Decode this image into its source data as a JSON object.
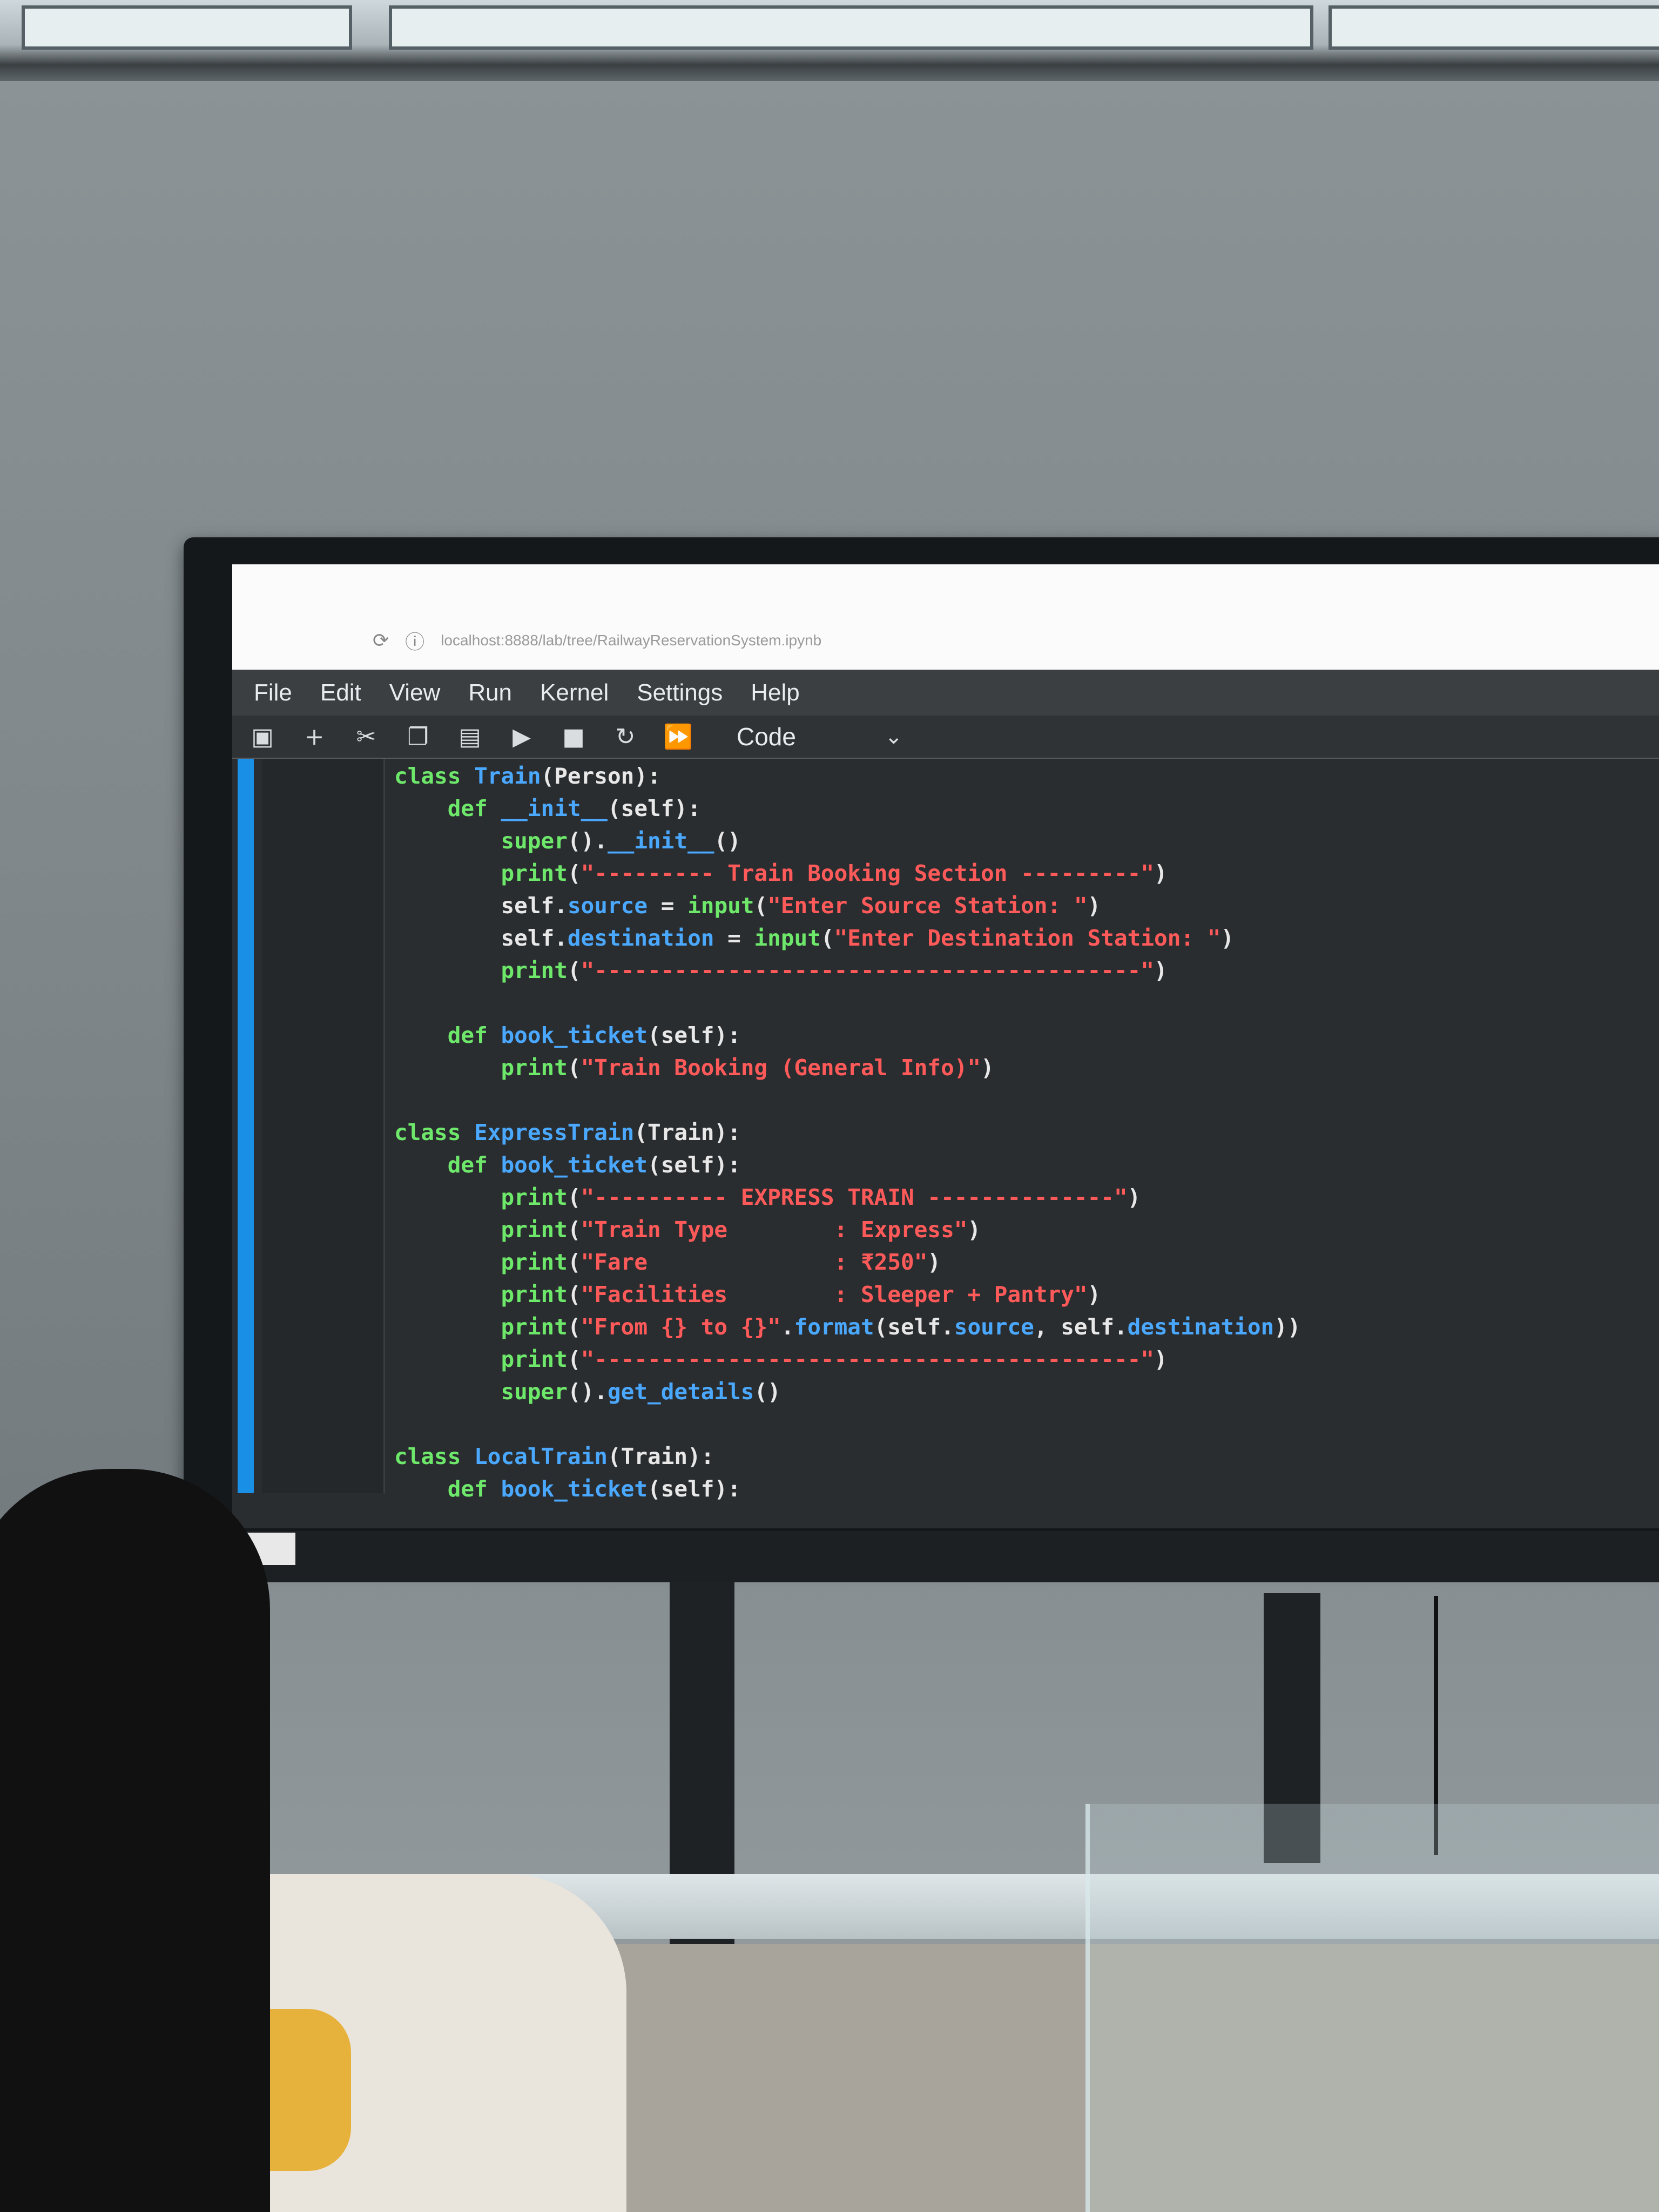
{
  "browser": {
    "url": "localhost:8888/lab/tree/RailwayReservationSystem.ipynb"
  },
  "menubar": {
    "items": [
      "File",
      "Edit",
      "View",
      "Run",
      "Kernel",
      "Settings",
      "Help"
    ]
  },
  "toolbar": {
    "icons": [
      "save-icon",
      "add-cell-icon",
      "cut-icon",
      "copy-icon",
      "paste-icon",
      "run-icon",
      "stop-icon",
      "restart-icon",
      "fast-forward-icon"
    ],
    "cell_type": "Code"
  },
  "code_lines": [
    "class Train(Person):",
    "    def __init__(self):",
    "        super().__init__()",
    "        print(\"--------- Train Booking Section ---------\")",
    "        self.source = input(\"Enter Source Station: \")",
    "        self.destination = input(\"Enter Destination Station: \")",
    "        print(\"-----------------------------------------\")",
    "",
    "    def book_ticket(self):",
    "        print(\"Train Booking (General Info)\")",
    "",
    "class ExpressTrain(Train):",
    "    def book_ticket(self):",
    "        print(\"---------- EXPRESS TRAIN --------------\")",
    "        print(\"Train Type        : Express\")",
    "        print(\"Fare              : ₹250\")",
    "        print(\"Facilities        : Sleeper + Pantry\")",
    "        print(\"From {} to {}\".format(self.source, self.destination))",
    "        print(\"-----------------------------------------\")",
    "        super().get_details()",
    "",
    "class LocalTrain(Train):",
    "    def book_ticket(self):"
  ]
}
